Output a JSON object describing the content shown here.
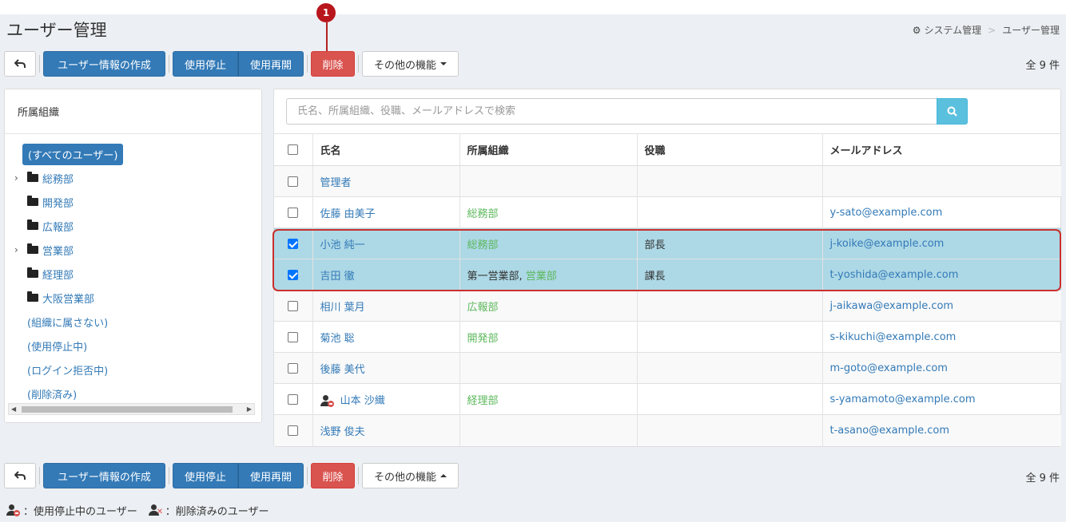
{
  "page": {
    "title": "ユーザー管理",
    "breadcrumb": [
      "システム管理",
      "ユーザー管理"
    ]
  },
  "marker": "1",
  "toolbar": {
    "create": "ユーザー情報の作成",
    "suspend": "使用停止",
    "resume": "使用再開",
    "delete": "削除",
    "other": "その他の機能",
    "count": "全 9 件"
  },
  "left": {
    "header": "所属組織",
    "all_users": "(すべてのユーザー)",
    "orgs": [
      {
        "label": "総務部",
        "expandable": true
      },
      {
        "label": "開発部",
        "expandable": false
      },
      {
        "label": "広報部",
        "expandable": false
      },
      {
        "label": "営業部",
        "expandable": true
      },
      {
        "label": "経理部",
        "expandable": false
      },
      {
        "label": "大阪営業部",
        "expandable": false
      }
    ],
    "special": [
      "(組織に属さない)",
      "(使用停止中)",
      "(ログイン拒否中)",
      "(削除済み)"
    ]
  },
  "search": {
    "placeholder": "氏名、所属組織、役職、メールアドレスで検索"
  },
  "table": {
    "headers": [
      "氏名",
      "所属組織",
      "役職",
      "メールアドレス"
    ],
    "rows": [
      {
        "name": "管理者",
        "org": "",
        "org_prefix": "",
        "title": "",
        "email": "",
        "checked": false,
        "suspended": false
      },
      {
        "name": "佐藤 由美子",
        "org": "総務部",
        "org_prefix": "",
        "title": "",
        "email": "y-sato@example.com",
        "checked": false,
        "suspended": false
      },
      {
        "name": "小池 純一",
        "org": "総務部",
        "org_prefix": "",
        "title": "部長",
        "email": "j-koike@example.com",
        "checked": true,
        "suspended": false
      },
      {
        "name": "吉田 徹",
        "org": "営業部",
        "org_prefix": "第一営業部, ",
        "title": "課長",
        "email": "t-yoshida@example.com",
        "checked": true,
        "suspended": false
      },
      {
        "name": "相川 葉月",
        "org": "広報部",
        "org_prefix": "",
        "title": "",
        "email": "j-aikawa@example.com",
        "checked": false,
        "suspended": false
      },
      {
        "name": "菊池 聡",
        "org": "開発部",
        "org_prefix": "",
        "title": "",
        "email": "s-kikuchi@example.com",
        "checked": false,
        "suspended": false
      },
      {
        "name": "後藤 美代",
        "org": "",
        "org_prefix": "",
        "title": "",
        "email": "m-goto@example.com",
        "checked": false,
        "suspended": false
      },
      {
        "name": "山本 沙織",
        "org": "経理部",
        "org_prefix": "",
        "title": "",
        "email": "s-yamamoto@example.com",
        "checked": false,
        "suspended": true
      },
      {
        "name": "浅野 俊夫",
        "org": "",
        "org_prefix": "",
        "title": "",
        "email": "t-asano@example.com",
        "checked": false,
        "suspended": false
      }
    ]
  },
  "legend": {
    "suspended": "：使用停止中のユーザー",
    "deleted": "：削除済みのユーザー"
  },
  "icons": [
    "back-arrow-icon",
    "gear-icon",
    "search-icon",
    "folder-icon",
    "chevron-right-icon",
    "suspended-user-icon",
    "deleted-user-icon"
  ],
  "colors": {
    "primary": "#337ab7",
    "danger": "#d9534f",
    "info": "#5bc0de",
    "selected_row": "#add8e6",
    "org_link": "#5cb85c",
    "marker": "#b8161c"
  }
}
